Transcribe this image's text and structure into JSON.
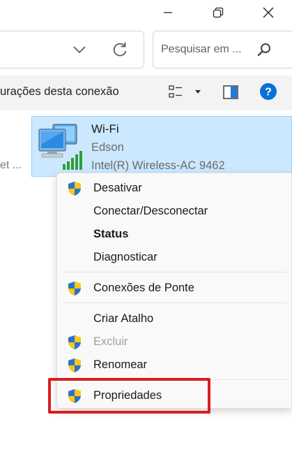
{
  "window": {
    "controls": [
      "minimize",
      "maximize",
      "close"
    ]
  },
  "address_bar": {
    "icons": [
      "chevron-down-icon",
      "refresh-icon"
    ]
  },
  "search": {
    "placeholder": "Pesquisar em ..."
  },
  "command_bar": {
    "text": "urações desta conexão",
    "icons": [
      "view-options-icon",
      "dropdown-arrow-icon",
      "preview-pane-icon",
      "help-icon"
    ]
  },
  "left_clipped_item": {
    "text": "et ..."
  },
  "network_item": {
    "name": "Wi-Fi",
    "subtitle": "Edson",
    "adapter": "Intel(R) Wireless-AC 9462",
    "icon": "wireless-network-icon",
    "selected": true
  },
  "context_menu": {
    "items": [
      {
        "label": "Desativar",
        "shield": true,
        "bold": false,
        "disabled": false
      },
      {
        "label": "Conectar/Desconectar",
        "shield": false,
        "bold": false,
        "disabled": false
      },
      {
        "label": "Status",
        "shield": false,
        "bold": true,
        "disabled": false
      },
      {
        "label": "Diagnosticar",
        "shield": false,
        "bold": false,
        "disabled": false
      },
      {
        "label": "Conexões de Ponte",
        "shield": true,
        "bold": false,
        "disabled": false
      },
      {
        "label": "Criar Atalho",
        "shield": false,
        "bold": false,
        "disabled": false
      },
      {
        "label": "Excluir",
        "shield": true,
        "bold": false,
        "disabled": true
      },
      {
        "label": "Renomear",
        "shield": true,
        "bold": false,
        "disabled": false
      },
      {
        "label": "Propriedades",
        "shield": true,
        "bold": false,
        "disabled": false,
        "highlighted": true
      }
    ]
  },
  "colors": {
    "selection_bg": "#cce8ff",
    "selection_border": "#99d1ff",
    "highlight_box": "#d91e1e",
    "help_blue": "#0a6fd6"
  }
}
